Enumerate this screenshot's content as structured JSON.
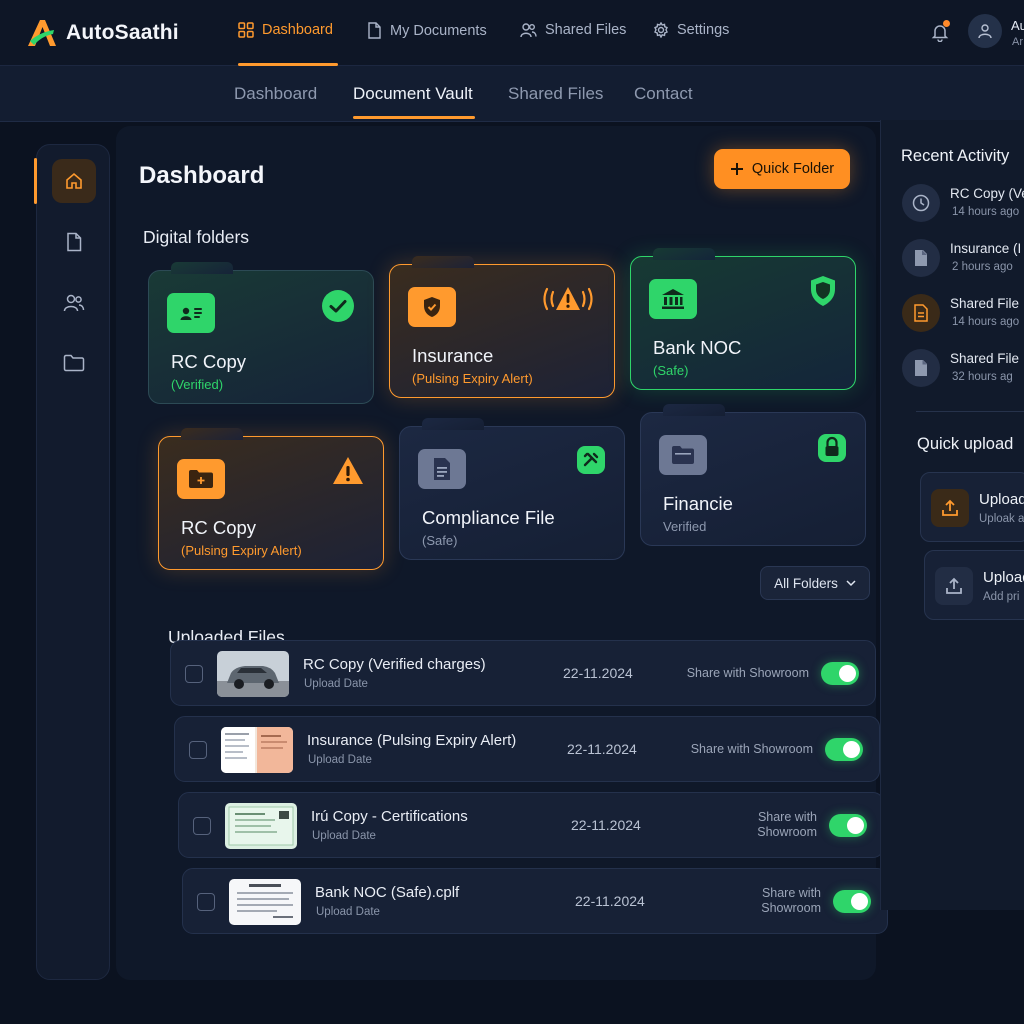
{
  "app": {
    "name": "AutoSaathi"
  },
  "topnav": [
    {
      "label": "Dashboard",
      "icon": "grid-icon"
    },
    {
      "label": "My Documents",
      "icon": "document-icon"
    },
    {
      "label": "Shared Files",
      "icon": "users-icon"
    },
    {
      "label": "Settings",
      "icon": "gear-icon"
    }
  ],
  "user": {
    "name": "Au",
    "sub": "Ar"
  },
  "subtabs": [
    "Dashboard",
    "Document Vault",
    "Shared Files",
    "Contact"
  ],
  "main": {
    "title": "Dashboard",
    "quick_folder": "Quick Folder",
    "folders_title": "Digital folders",
    "folders": [
      {
        "name": "RC Copy",
        "status": "(Verified)"
      },
      {
        "name": "Insurance",
        "status": "(Pulsing Expiry Alert)"
      },
      {
        "name": "Bank NOC",
        "status": "(Safe)"
      },
      {
        "name": "RC Copy",
        "status": "(Pulsing Expiry Alert)"
      },
      {
        "name": "Compliance File",
        "status": "(Safe)"
      },
      {
        "name": "Financie",
        "status": "Verified"
      }
    ],
    "all_folders": "All Folders",
    "uploaded_title": "Uploaded Files",
    "files": [
      {
        "name": "RC Copy (Verified charges)",
        "sub": "Upload Date",
        "date": "22-11.2024",
        "share": "Share with Showroom"
      },
      {
        "name": "Insurance (Pulsing Expiry Alert)",
        "sub": "Upload Date",
        "date": "22-11.2024",
        "share": "Share with Showroom"
      },
      {
        "name": "Irú Copy - Certifications",
        "sub": "Upload Date",
        "date": "22-11.2024",
        "share": "Share with\nShowroom"
      },
      {
        "name": "Bank NOC (Safe).cplf",
        "sub": "Upload Date",
        "date": "22-11.2024",
        "share": "Share with\nShowroom"
      }
    ]
  },
  "right": {
    "activity_title": "Recent Activity",
    "activity": [
      {
        "title": "RC Copy (Ve",
        "time": "14 hours ago"
      },
      {
        "title": "Insurance (I",
        "time": "2 hours ago"
      },
      {
        "title": "Shared File",
        "time": "14 hours ago"
      },
      {
        "title": "Shared File",
        "time": "32 hours ag"
      }
    ],
    "upload_title": "Quick upload",
    "uploads": [
      {
        "title": "Upload",
        "sub": "Uploak a"
      },
      {
        "title": "Upload",
        "sub": "Add pri"
      }
    ]
  },
  "colors": {
    "accent": "#ff9a2e",
    "success": "#2fd56a",
    "background": "#0b1220"
  }
}
